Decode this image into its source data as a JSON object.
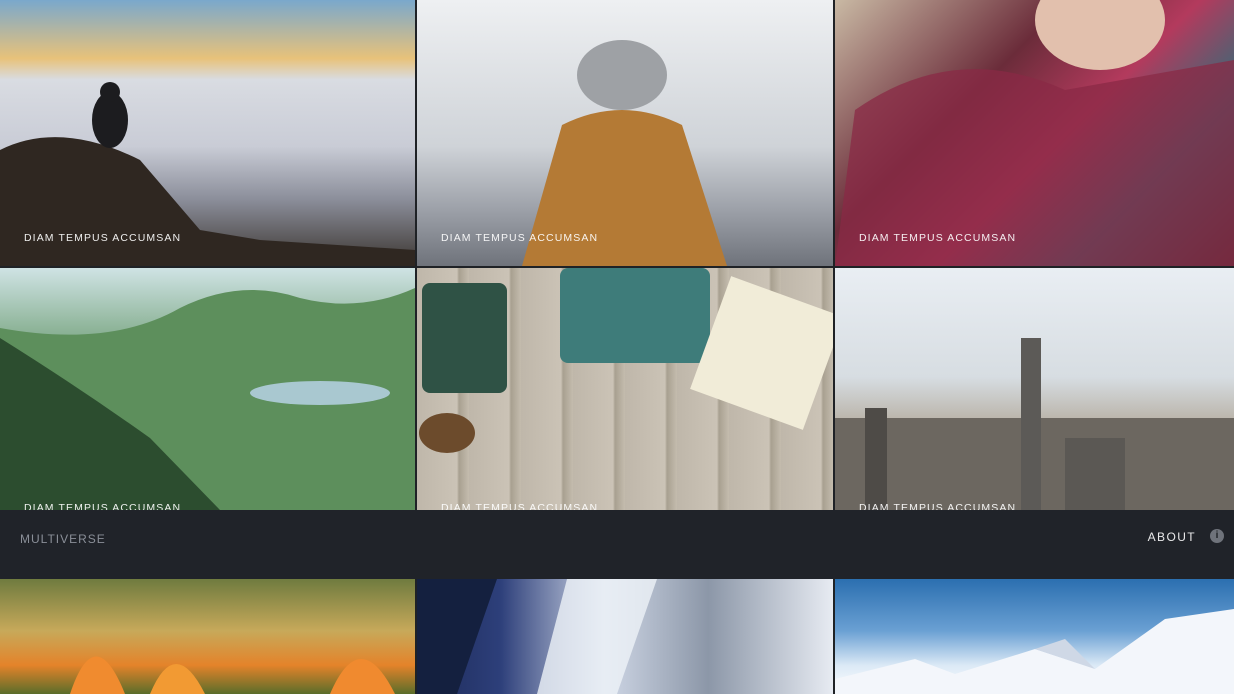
{
  "gallery": {
    "captions": [
      "DIAM TEMPUS ACCUMSAN",
      "DIAM TEMPUS ACCUMSAN",
      "DIAM TEMPUS ACCUMSAN",
      "DIAM TEMPUS ACCUMSAN",
      "DIAM TEMPUS ACCUMSAN",
      "DIAM TEMPUS ACCUMSAN"
    ]
  },
  "header": {
    "brand": "MULTIVERSE",
    "about_label": "ABOUT",
    "info_icon_glyph": "i"
  }
}
